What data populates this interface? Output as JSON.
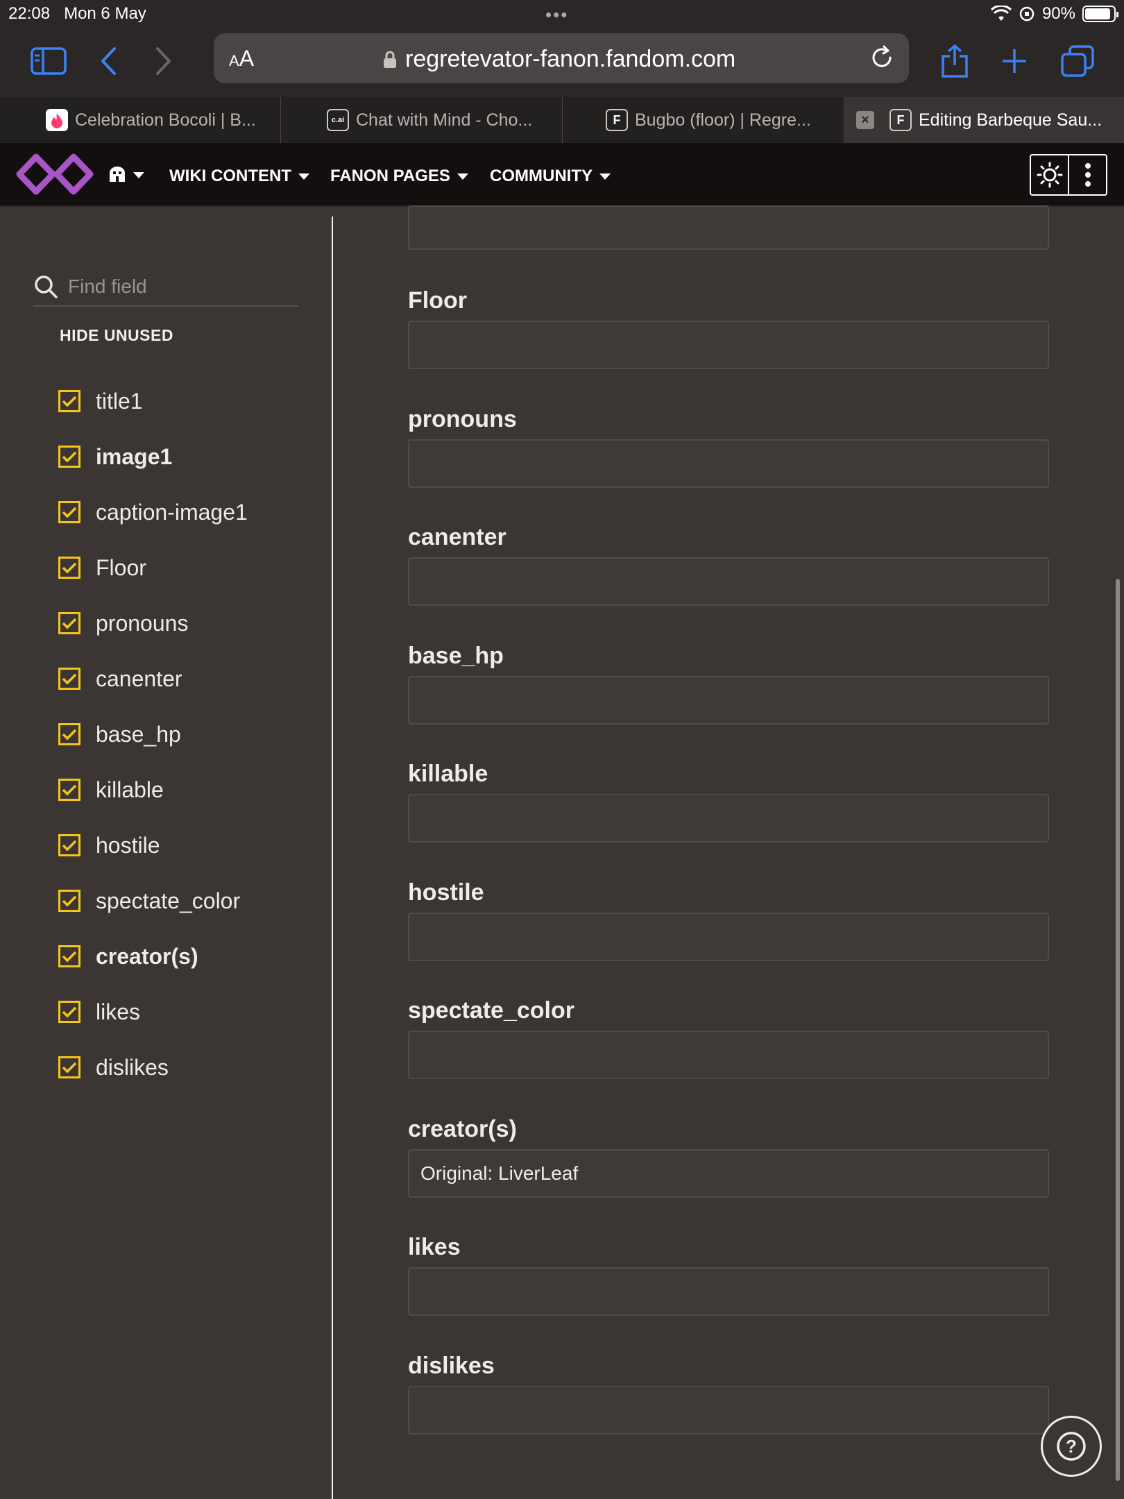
{
  "status_bar": {
    "time": "22:08",
    "date": "Mon 6 May",
    "battery": "90%"
  },
  "browser": {
    "aa_label_small": "A",
    "aa_label_large": "A",
    "url": "regretevator-fanon.fandom.com",
    "tabs": [
      {
        "title": "Celebration Bocoli | B...",
        "favicon": "tinder-icon",
        "active": false
      },
      {
        "title": "Chat with Mind - Cho...",
        "favicon": "c.ai",
        "active": false
      },
      {
        "title": "Bugbo (floor) | Regre...",
        "favicon": "F",
        "active": false
      },
      {
        "title": "Editing Barbeque Sau...",
        "favicon": "F",
        "active": true
      }
    ]
  },
  "nav": {
    "items": [
      "WIKI CONTENT",
      "FANON PAGES",
      "COMMUNITY"
    ],
    "accent": "#a855c8"
  },
  "sidebar": {
    "find_placeholder": "Find field",
    "hide_unused": "HIDE UNUSED",
    "checkbox_color": "#f5c518",
    "fields": [
      {
        "label": "title1",
        "bold": false
      },
      {
        "label": "image1",
        "bold": true
      },
      {
        "label": "caption-image1",
        "bold": false
      },
      {
        "label": "Floor",
        "bold": false
      },
      {
        "label": "pronouns",
        "bold": false
      },
      {
        "label": "canenter",
        "bold": false
      },
      {
        "label": "base_hp",
        "bold": false
      },
      {
        "label": "killable",
        "bold": false
      },
      {
        "label": "hostile",
        "bold": false
      },
      {
        "label": "spectate_color",
        "bold": false
      },
      {
        "label": "creator(s)",
        "bold": true
      },
      {
        "label": "likes",
        "bold": false
      },
      {
        "label": "dislikes",
        "bold": false
      }
    ]
  },
  "form": {
    "fields": [
      {
        "label": "Floor",
        "value": ""
      },
      {
        "label": "pronouns",
        "value": ""
      },
      {
        "label": "canenter",
        "value": ""
      },
      {
        "label": "base_hp",
        "value": ""
      },
      {
        "label": "killable",
        "value": ""
      },
      {
        "label": "hostile",
        "value": ""
      },
      {
        "label": "spectate_color",
        "value": ""
      },
      {
        "label": "creator(s)",
        "value": "Original: LiverLeaf"
      },
      {
        "label": "likes",
        "value": ""
      },
      {
        "label": "dislikes",
        "value": ""
      }
    ]
  },
  "help_label": "?"
}
